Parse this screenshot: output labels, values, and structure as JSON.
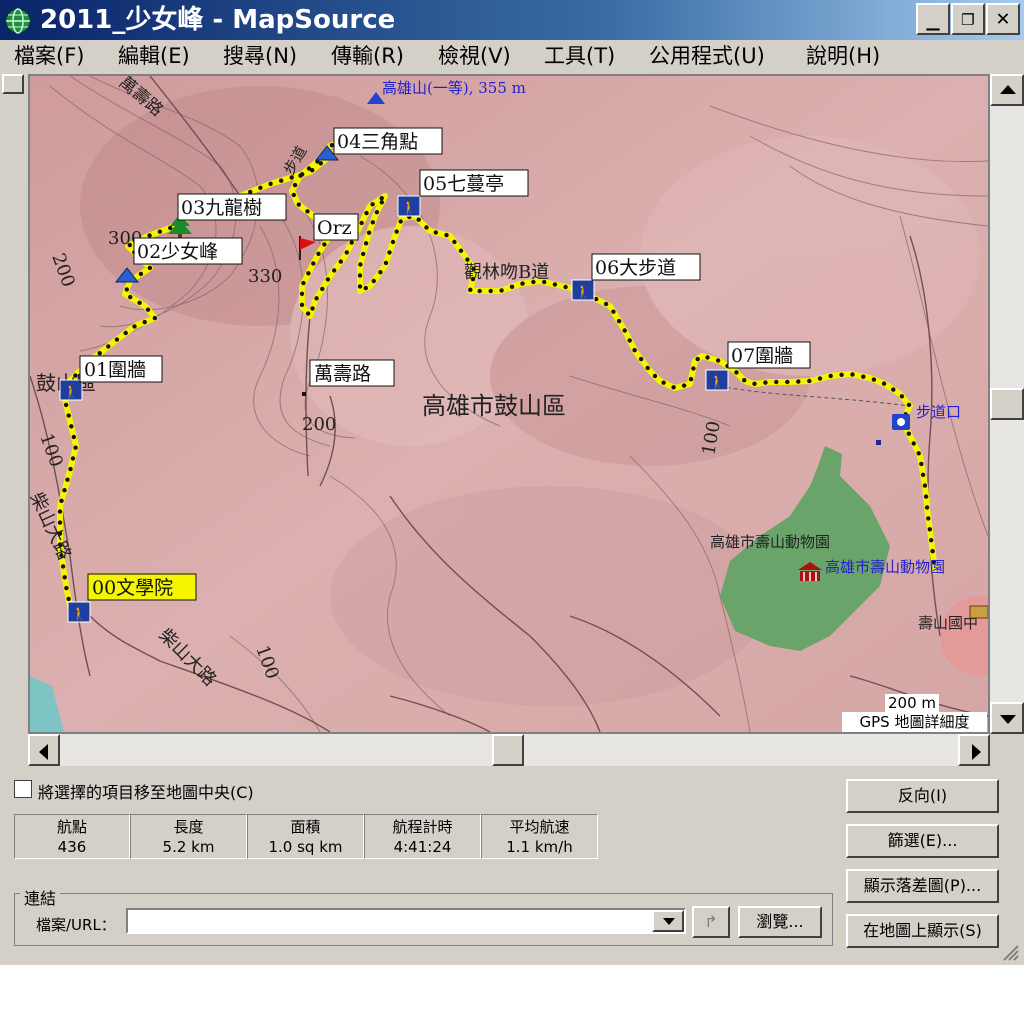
{
  "window": {
    "title": "2011_少女峰 - MapSource",
    "controls": {
      "minimize": "_",
      "restore": "❐",
      "close": "✕"
    }
  },
  "menu": [
    {
      "label": "檔案(F)"
    },
    {
      "label": "編輯(E)"
    },
    {
      "label": "搜尋(N)"
    },
    {
      "label": "傳輸(R)"
    },
    {
      "label": "檢視(V)"
    },
    {
      "label": "工具(T)"
    },
    {
      "label": "公用程式(U)"
    },
    {
      "label": "說明(H)"
    }
  ],
  "map": {
    "district_label": "高雄市鼓山區",
    "peak_label": "高雄山(一等), 355 m",
    "trail_label": "觀林吻B道",
    "trailhead_label": "步道口",
    "zoo_label_1": "高雄市壽山動物園",
    "zoo_label_2": "高雄市壽山動物園",
    "school_label": "壽山國中",
    "path_label_1": "步道",
    "road_1": "萬壽路",
    "road_2": "柴山大路",
    "road_3": "柴山大路",
    "road_4": "鼓山區",
    "contours": [
      "200",
      "300",
      "330",
      "200",
      "100",
      "100",
      "100"
    ],
    "waypoints": [
      {
        "label": "00文學院"
      },
      {
        "label": "01圍牆"
      },
      {
        "label": "02少女峰"
      },
      {
        "label": "03九龍樹"
      },
      {
        "label": "04三角點"
      },
      {
        "label": "Orz"
      },
      {
        "label": "05七蔓亭"
      },
      {
        "label": "06大步道"
      },
      {
        "label": "07圍牆"
      },
      {
        "label": "萬壽路"
      }
    ],
    "scale_value": "200 m",
    "detail_label": "GPS 地圖詳細度",
    "colors": {
      "terrain": "#d8a8a8",
      "track": "#f5f500",
      "park": "#6aa46a"
    }
  },
  "panel": {
    "center_checkbox_label": "將選擇的項目移至地圖中央(C)",
    "stats": [
      {
        "header": "航點",
        "value": "436"
      },
      {
        "header": "長度",
        "value": "5.2 km"
      },
      {
        "header": "面積",
        "value": "1.0 sq km"
      },
      {
        "header": "航程計時",
        "value": "4:41:24"
      },
      {
        "header": "平均航速",
        "value": "1.1 km/h"
      }
    ],
    "link_group_label": "連結",
    "file_url_label": "檔案/URL：",
    "file_url_value": "",
    "browse_label": "瀏覽...",
    "buttons": {
      "reverse": "反向(I)",
      "filter": "篩選(E)...",
      "profile": "顯示落差圖(P)...",
      "show_on_map": "在地圖上顯示(S)"
    }
  }
}
